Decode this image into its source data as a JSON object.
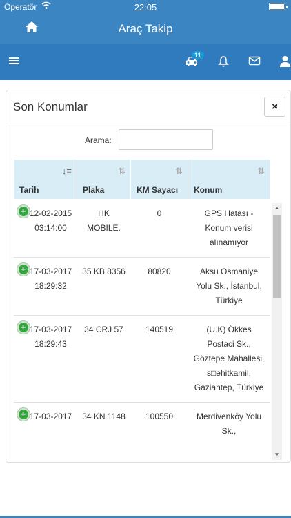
{
  "status_bar": {
    "carrier": "Operatör",
    "time": "22:05"
  },
  "header": {
    "title": "Araç Takip"
  },
  "nav": {
    "badge_count": "11"
  },
  "panel": {
    "title": "Son Konumlar",
    "close_label": "×",
    "search_label": "Arama:",
    "search_value": ""
  },
  "table": {
    "columns": [
      "Tarih",
      "Plaka",
      "KM Sayacı",
      "Konum"
    ],
    "rows": [
      {
        "date": "12-02-2015 03:14:00",
        "plate": "HK MOBILE.",
        "km": "0",
        "location": "GPS Hatası - Konum verisi alınamıyor"
      },
      {
        "date": "17-03-2017 18:29:32",
        "plate": "35 KB 8356",
        "km": "80820",
        "location": "Aksu Osmaniye Yolu Sk., İstanbul, Türkiye"
      },
      {
        "date": "17-03-2017 18:29:43",
        "plate": "34 CRJ 57",
        "km": "140519",
        "location": "(U.K) Ökkes Postaci Sk., Göztepe Mahallesi, s□ehitkamil, Gaziantep, Türkiye"
      },
      {
        "date": "17-03-2017",
        "plate": "34 KN 1148",
        "km": "100550",
        "location": "Merdivenköy Yolu Sk.,"
      }
    ]
  },
  "colors": {
    "primary": "#3b85c2",
    "nav": "#2f7bbd",
    "header_cell": "#d9edf7",
    "expand": "#2eaa3a"
  }
}
